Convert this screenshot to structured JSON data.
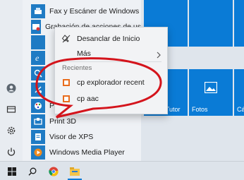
{
  "apps": [
    {
      "label": "Fax y Escáner de Windows",
      "color": "#1f7bc4"
    },
    {
      "label": "Grabación de acciones de usuario",
      "color": "#1f7bc4"
    },
    {
      "label": "",
      "color": "#1f7bc4"
    },
    {
      "label": "",
      "color": "#1f7bc4"
    },
    {
      "label": "",
      "color": "#1f7bc4"
    },
    {
      "label": "",
      "color": "#1f7bc4"
    },
    {
      "label": "Paint",
      "color": "#1f7bc4"
    },
    {
      "label": "Print 3D",
      "color": "#1f7bc4"
    },
    {
      "label": "Visor de XPS",
      "color": "#1f7bc4"
    },
    {
      "label": "Windows Media Player",
      "color": "#1f7bc4"
    }
  ],
  "context_menu": {
    "unpin": "Desanclar de Inicio",
    "more": "Más",
    "recent_header": "Recientes",
    "recent_items": [
      "cp explorador recent",
      "cp aac"
    ]
  },
  "tiles": {
    "asus_tutor": "ASUS Tutor",
    "photos": "Fotos",
    "camera": "Cám"
  },
  "colors": {
    "accent": "#0a7bd6",
    "annotation": "#d4141c"
  }
}
